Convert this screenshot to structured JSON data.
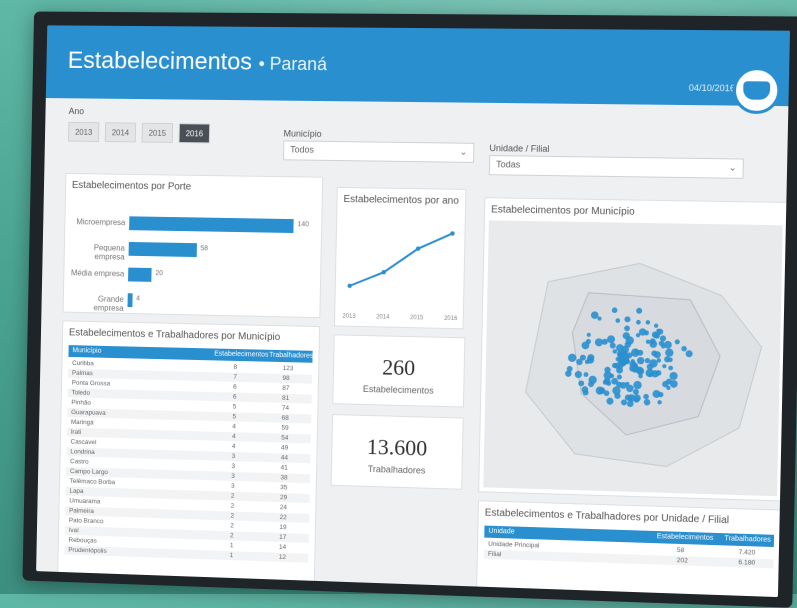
{
  "header": {
    "title": "Estabelecimentos",
    "subtitle": "• Paraná",
    "date": "04/10/2016"
  },
  "filters": {
    "year_label": "Ano",
    "years": [
      "2013",
      "2014",
      "2015",
      "2016"
    ],
    "selected_year": "2016",
    "municipio_label": "Município",
    "municipio_value": "Todos",
    "unidade_label": "Unidade / Filial",
    "unidade_value": "Todas"
  },
  "porte_chart": {
    "title": "Estabelecimentos por Porte",
    "categories": [
      "Microempresa",
      "Pequena empresa",
      "Média empresa",
      "Grande empresa"
    ],
    "values": [
      140,
      58,
      20,
      4
    ]
  },
  "trend_chart": {
    "title": "Estabelecimentos por ano",
    "x": [
      "2013",
      "2014",
      "2015",
      "2016"
    ],
    "values": [
      70,
      120,
      205,
      260
    ]
  },
  "kpis": {
    "estabelecimentos_value": "260",
    "estabelecimentos_label": "Estabelecimentos",
    "trabalhadores_value": "13.600",
    "trabalhadores_label": "Trabalhadores"
  },
  "map": {
    "title": "Estabelecimentos por Município"
  },
  "municipio_table": {
    "title": "Estabelecimentos e Trabalhadores por Município",
    "columns": [
      "Município",
      "Estabelecimentos",
      "Trabalhadores"
    ],
    "rows": [
      [
        "Curitiba",
        "8",
        "123"
      ],
      [
        "Palmas",
        "7",
        "98"
      ],
      [
        "Ponta Grossa",
        "6",
        "87"
      ],
      [
        "Toledo",
        "6",
        "81"
      ],
      [
        "Pinhão",
        "5",
        "74"
      ],
      [
        "Guarapuava",
        "5",
        "68"
      ],
      [
        "Maringá",
        "4",
        "59"
      ],
      [
        "Irati",
        "4",
        "54"
      ],
      [
        "Cascavel",
        "4",
        "49"
      ],
      [
        "Londrina",
        "3",
        "44"
      ],
      [
        "Castro",
        "3",
        "41"
      ],
      [
        "Campo Largo",
        "3",
        "38"
      ],
      [
        "Telêmaco Borba",
        "3",
        "35"
      ],
      [
        "Lapa",
        "2",
        "29"
      ],
      [
        "Umuarama",
        "2",
        "24"
      ],
      [
        "Palmeira",
        "2",
        "22"
      ],
      [
        "Pato Branco",
        "2",
        "19"
      ],
      [
        "Ivaí",
        "2",
        "17"
      ],
      [
        "Rebouças",
        "1",
        "14"
      ],
      [
        "Prudentópolis",
        "1",
        "12"
      ]
    ]
  },
  "unidade_table": {
    "title": "Estabelecimentos e Trabalhadores por Unidade / Filial",
    "columns": [
      "Unidade",
      "Estabelecimentos",
      "Trabalhadores"
    ],
    "rows": [
      [
        "Unidade Principal",
        "58",
        "7.420"
      ],
      [
        "Filial",
        "202",
        "6.180"
      ]
    ]
  },
  "colors": {
    "accent": "#2a8fcf",
    "background": "#4aa391"
  }
}
